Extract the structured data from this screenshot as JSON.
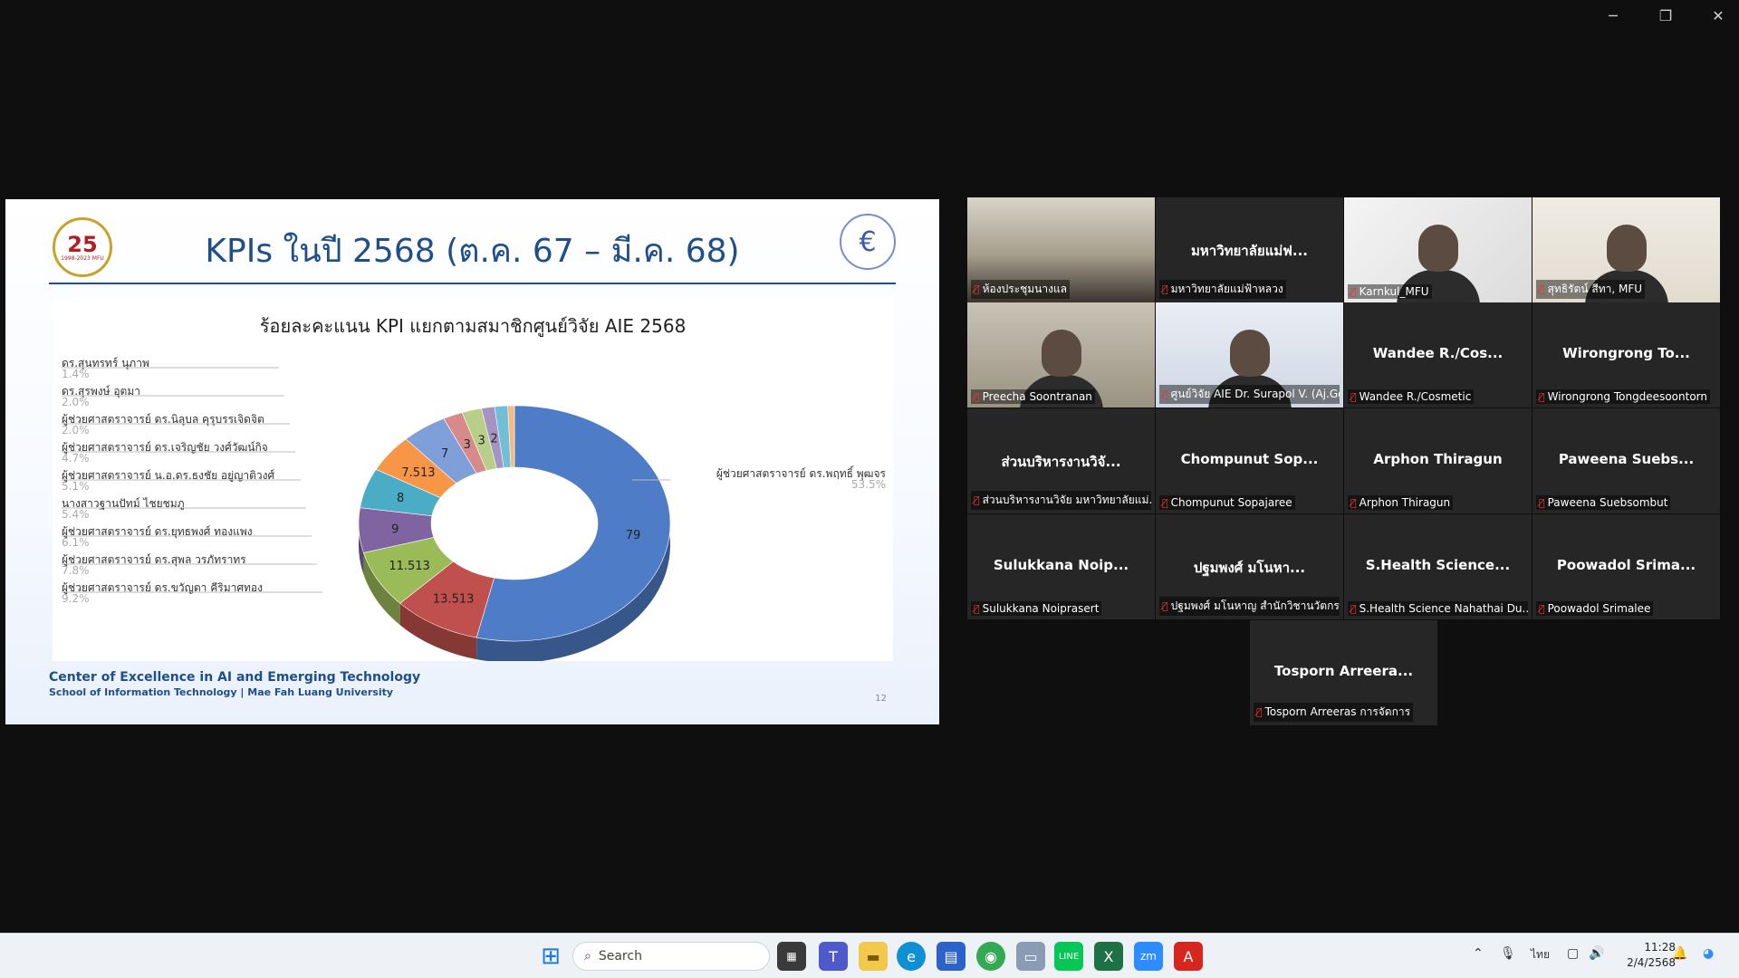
{
  "window": {
    "minimize": "─",
    "restore": "❐",
    "close": "✕"
  },
  "slide": {
    "title": "KPIs ในปี 2568 (ต.ค. 67 – มี.ค. 68)",
    "logo_left_number": "25",
    "logo_left_sub": "1998-2023 MFU",
    "footer_line1": "Center of Excellence in AI and Emerging Technology",
    "footer_line2": "School of Information Technology | Mae Fah Luang University",
    "page_number": "12"
  },
  "chart_data": {
    "type": "pie",
    "title": "ร้อยละคะแนน KPI แยกตามสมาชิกศูนย์วิจัย AIE 2568",
    "series": [
      {
        "name": "ผู้ช่วยศาสตราจารย์ ดร.พฤทธิ์ พุฒจร",
        "value": 79,
        "label": "79",
        "percent": "53.5%",
        "color": "#4f7cc6"
      },
      {
        "name": "ผู้ช่วยศาสตราจารย์ ดร.ขวัญตา คีริมาศทอง",
        "value": 13.513,
        "label": "13.513",
        "percent": "9.2%",
        "color": "#c0504d"
      },
      {
        "name": "ผู้ช่วยศาสตราจารย์ ดร.สุพล วรภัทราทร",
        "value": 11.513,
        "label": "11.513",
        "percent": "7.8%",
        "color": "#9bbb59"
      },
      {
        "name": "ผู้ช่วยศาสตราจารย์ ดร.ยุทธพงศ์ ทองแพง",
        "value": 9,
        "label": "9",
        "percent": "6.1%",
        "color": "#8064a2"
      },
      {
        "name": "นางสาวฐานปัทม์ ไชยชมภู",
        "value": 8,
        "label": "8",
        "percent": "5.4%",
        "color": "#4bacc6"
      },
      {
        "name": "ผู้ช่วยศาสตราจารย์ น.อ.ดร.ธงชัย อยู่ญาติวงศ์",
        "value": 7.513,
        "label": "7.513",
        "percent": "5.1%",
        "color": "#f79646"
      },
      {
        "name": "ผู้ช่วยศาสตราจารย์ ดร.เจริญชัย วงศ์วัฒน์กิจ",
        "value": 7,
        "label": "7",
        "percent": "4.7%",
        "color": "#7f9fd8"
      },
      {
        "name": "ผู้ช่วยศาสตราจารย์ ดร.นิลุบล คุรุบรรเจิดจิต",
        "value": 3,
        "label": "3",
        "percent": "2.0%",
        "color": "#d78a8a"
      },
      {
        "name": "ดร.สุรพงษ์ อุตมา",
        "value": 3,
        "label": "3",
        "percent": "2.0%",
        "color": "#b8cf8a"
      },
      {
        "name": "ดร.สุนทรทร์ นุภาพ",
        "value": 2,
        "label": "2",
        "percent": "1.4%",
        "color": "#a593c2"
      },
      {
        "name": "",
        "value": 2,
        "label": "",
        "percent": "",
        "color": "#6fc0d6"
      },
      {
        "name": "",
        "value": 1,
        "label": "",
        "percent": "",
        "color": "#f6b97f"
      }
    ]
  },
  "gallery": [
    {
      "name": "",
      "label": "ห้องประชุมนางแล",
      "video": "room"
    },
    {
      "name": "มหาวิทยาลัยแม่ฟ...",
      "label": "มหาวิทยาลัยแม่ฟ้าหลวง",
      "video": ""
    },
    {
      "name": "",
      "label": "Karnkul_MFU",
      "video": "person"
    },
    {
      "name": "",
      "label": "สุทธิรัตน์ สีทา, MFU",
      "video": "person2"
    },
    {
      "name": "",
      "label": "Preecha Soontranan",
      "video": "person3"
    },
    {
      "name": "",
      "label": "ศูนย์วิจัย AIE Dr. Surapol V. (Aj.God)",
      "video": "active"
    },
    {
      "name": "Wandee R./Cos...",
      "label": "Wandee R./Cosmetic",
      "video": ""
    },
    {
      "name": "Wirongrong To...",
      "label": "Wirongrong Tongdeesoontorn",
      "video": ""
    },
    {
      "name": "ส่วนบริหารงานวิจั...",
      "label": "ส่วนบริหารงานวิจัย มหาวิทยาลัยแม่...",
      "video": ""
    },
    {
      "name": "Chompunut Sop...",
      "label": "Chompunut Sopajaree",
      "video": ""
    },
    {
      "name": "Arphon Thiragun",
      "label": "Arphon Thiragun",
      "video": ""
    },
    {
      "name": "Paweena Suebs...",
      "label": "Paweena Suebsombut",
      "video": ""
    },
    {
      "name": "Sulukkana Noip...",
      "label": "Sulukkana Noiprasert",
      "video": ""
    },
    {
      "name": "ปฐมพงศ์ มโนหา...",
      "label": "ปฐมพงศ์ มโนหาญ สำนักวิชานวัตกร...",
      "video": ""
    },
    {
      "name": "S.Health Science...",
      "label": "S.Health Science Nahathai Du...",
      "video": ""
    },
    {
      "name": "Poowadol Srima...",
      "label": "Poowadol Srimalee",
      "video": ""
    },
    {
      "name": "Tosporn Arreera...",
      "label": "Tosporn Arreeras การจัดการ",
      "video": ""
    }
  ],
  "taskbar": {
    "search_placeholder": "Search",
    "lang": "ไทย",
    "time": "11:28",
    "date": "2/4/2568",
    "icons": [
      "start-icon",
      "search-icon",
      "task-view-icon",
      "teams-icon",
      "file-explorer-icon",
      "edge-icon",
      "store-icon",
      "chrome-icon",
      "photos-icon",
      "line-icon",
      "excel-icon",
      "zoom-icon",
      "acrobat-icon"
    ]
  }
}
